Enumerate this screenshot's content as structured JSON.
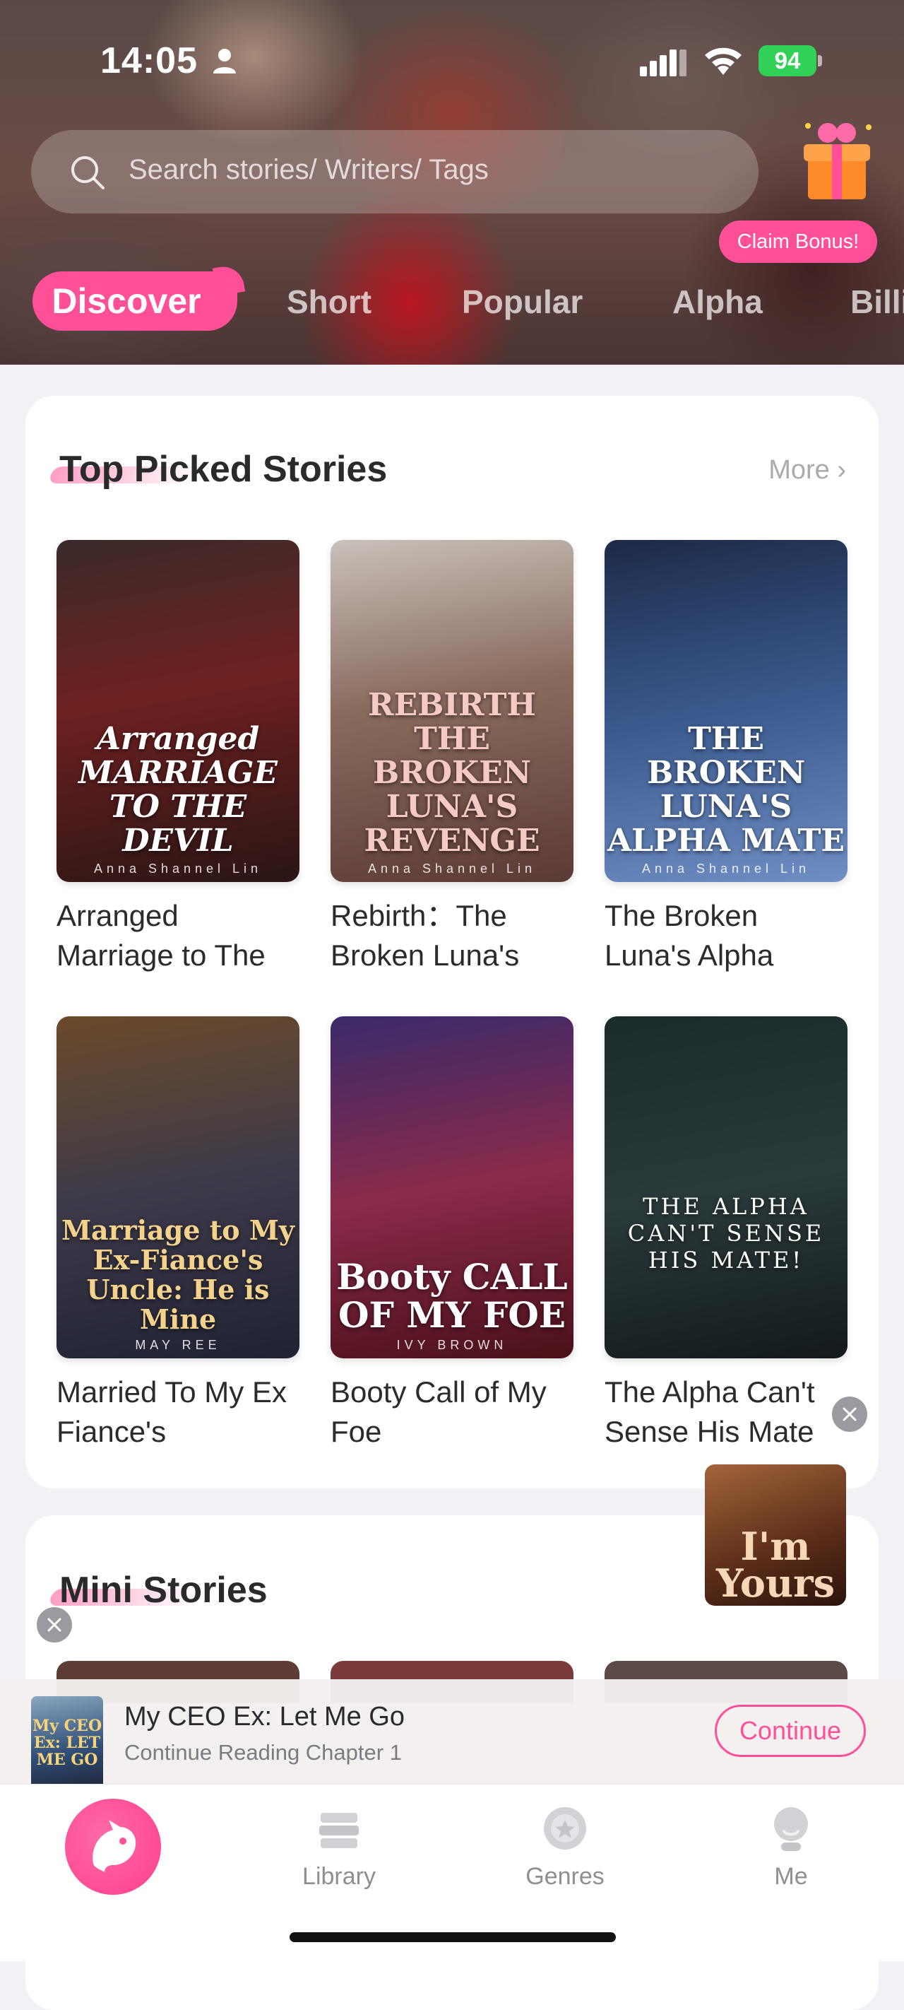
{
  "status_bar": {
    "time": "14:05",
    "battery": "94"
  },
  "search": {
    "placeholder": "Search stories/ Writers/ Tags"
  },
  "bonus": {
    "label": "Claim Bonus!"
  },
  "tabs": [
    "Discover",
    "Short",
    "Popular",
    "Alpha",
    "Billi"
  ],
  "top_picked": {
    "title": "Top Picked Stories",
    "more": "More",
    "books": [
      {
        "title": "Arranged Marriage to The",
        "cover_text": "Arranged MARRIAGE TO THE DEVIL",
        "author": "Anna Shannel Lin"
      },
      {
        "title": "Rebirth：The Broken Luna's",
        "cover_text": "REBIRTH THE BROKEN LUNA'S REVENGE",
        "author": "Anna Shannel Lin"
      },
      {
        "title": "The Broken Luna's Alpha",
        "cover_text": "THE BROKEN LUNA'S ALPHA MATE",
        "author": "Anna Shannel Lin"
      },
      {
        "title": "Married To My Ex Fiance's",
        "cover_text": "Marriage to My Ex-Fiance's Uncle: He is Mine",
        "author": "MAY REE"
      },
      {
        "title": "Booty Call of My Foe",
        "cover_text": "Booty CALL OF MY FOE",
        "author": "IVY BROWN"
      },
      {
        "title": "The Alpha Can't Sense His Mate",
        "cover_text": "THE ALPHA CAN'T SENSE HIS MATE!",
        "author": ""
      }
    ]
  },
  "mini_stories": {
    "title": "Mini Stories"
  },
  "floating_thumb": {
    "text": "I'm Yours"
  },
  "continue_reading": {
    "title": "My CEO Ex: Let Me Go",
    "subtitle": "Continue Reading Chapter 1",
    "button": "Continue",
    "cover_text": "My CEO Ex: LET ME GO"
  },
  "bottom_nav": {
    "library": "Library",
    "genres": "Genres",
    "me": "Me"
  },
  "colors": {
    "accent": "#ff4f96"
  }
}
